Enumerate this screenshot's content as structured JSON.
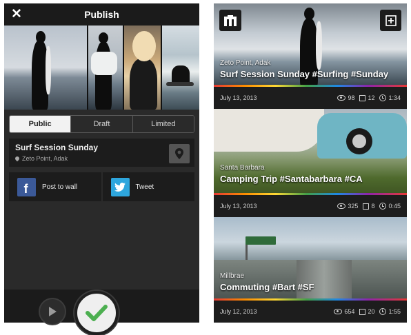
{
  "publish": {
    "title": "Publish",
    "tabs": [
      {
        "label": "Public",
        "active": true
      },
      {
        "label": "Draft",
        "active": false
      },
      {
        "label": "Limited",
        "active": false
      }
    ],
    "location_card": {
      "title": "Surf Session Sunday",
      "place": "Zeto Point, Adak"
    },
    "share": {
      "facebook_label": "Post to wall",
      "twitter_label": "Tweet"
    },
    "icons": {
      "close": "close-icon",
      "location": "map-pin-icon",
      "facebook": "facebook-icon",
      "twitter": "twitter-icon",
      "play": "play-icon",
      "confirm": "checkmark-icon"
    },
    "colors": {
      "facebook": "#3b5998",
      "twitter": "#2ea6dd",
      "confirm_check": "#4caf50"
    }
  },
  "feed": {
    "posts": [
      {
        "location": "Zeto Point, Adak",
        "title": "Surf Session Sunday #Surfing #Sunday",
        "date": "July 13, 2013",
        "views": "98",
        "clips": "12",
        "duration": "1:34"
      },
      {
        "location": "Santa Barbara",
        "title": "Camping Trip #Santabarbara #CA",
        "date": "July 13, 2013",
        "views": "325",
        "clips": "8",
        "duration": "0:45"
      },
      {
        "location": "Millbrae",
        "title": "Commuting #Bart #SF",
        "date": "July 12, 2013",
        "views": "654",
        "clips": "20",
        "duration": "1:55"
      }
    ],
    "icons": {
      "logo": "app-logo-icon",
      "add": "add-clip-icon"
    }
  }
}
